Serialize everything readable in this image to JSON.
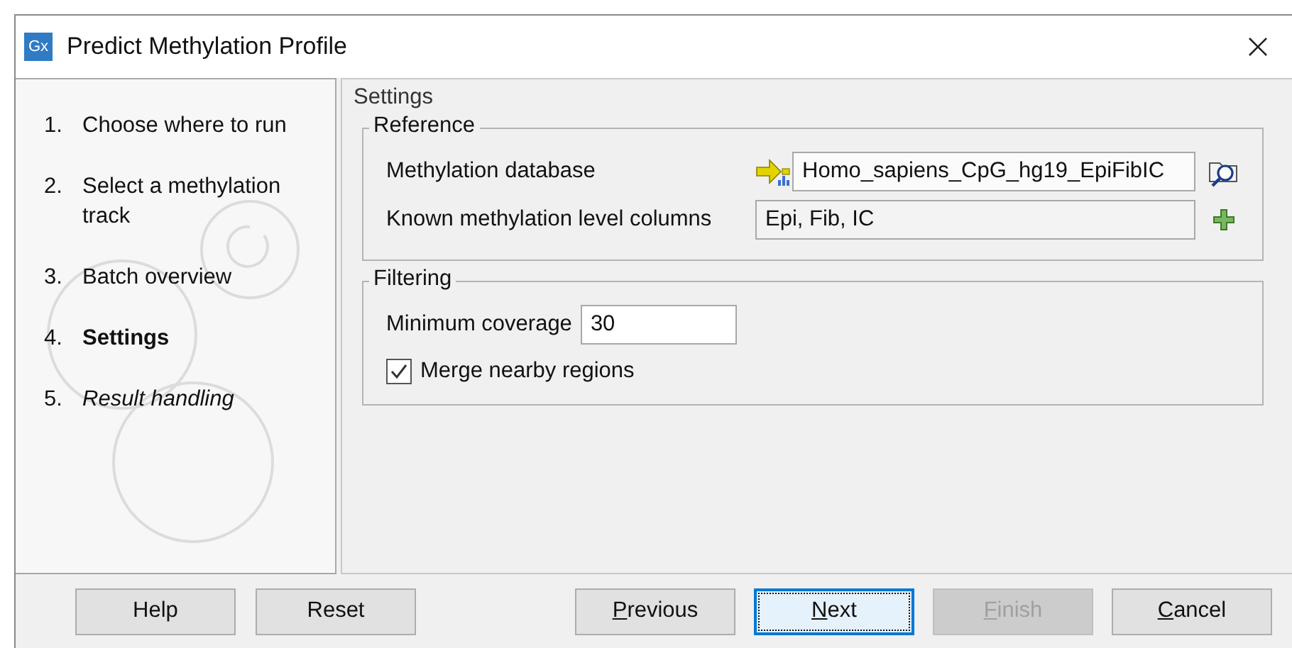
{
  "window": {
    "title": "Predict Methylation Profile",
    "app_icon": "Gx"
  },
  "steps": [
    {
      "number": "1.",
      "label": "Choose where to run",
      "selected": false,
      "pending": false
    },
    {
      "number": "2.",
      "label": "Select a methylation track",
      "selected": false,
      "pending": false
    },
    {
      "number": "3.",
      "label": "Batch overview",
      "selected": false,
      "pending": false
    },
    {
      "number": "4.",
      "label": "Settings",
      "selected": true,
      "pending": false
    },
    {
      "number": "5.",
      "label": "Result handling",
      "selected": false,
      "pending": true
    }
  ],
  "panel": {
    "title": "Settings",
    "groups": [
      {
        "title": "Reference",
        "rows": [
          {
            "kind": "picker",
            "label": "Methylation database",
            "value": "Homo_sapiens_CpG_hg19_EpiFibIC"
          },
          {
            "kind": "adder",
            "label": "Known methylation level columns",
            "value": "Epi, Fib, IC"
          }
        ]
      },
      {
        "title": "Filtering",
        "rows": [
          {
            "kind": "number",
            "label": "Minimum coverage",
            "value": "30"
          },
          {
            "kind": "checkbox",
            "label": "Merge nearby regions",
            "checked": true
          }
        ]
      }
    ]
  },
  "left_buttons": [
    {
      "label": "Help"
    },
    {
      "label": "Reset"
    }
  ],
  "nav_buttons": [
    {
      "label": "Previous",
      "focused": false,
      "disabled": false
    },
    {
      "label": "Next",
      "focused": true,
      "disabled": false
    },
    {
      "label": "Finish",
      "focused": false,
      "disabled": true
    },
    {
      "label": "Cancel",
      "focused": false,
      "disabled": false
    }
  ]
}
